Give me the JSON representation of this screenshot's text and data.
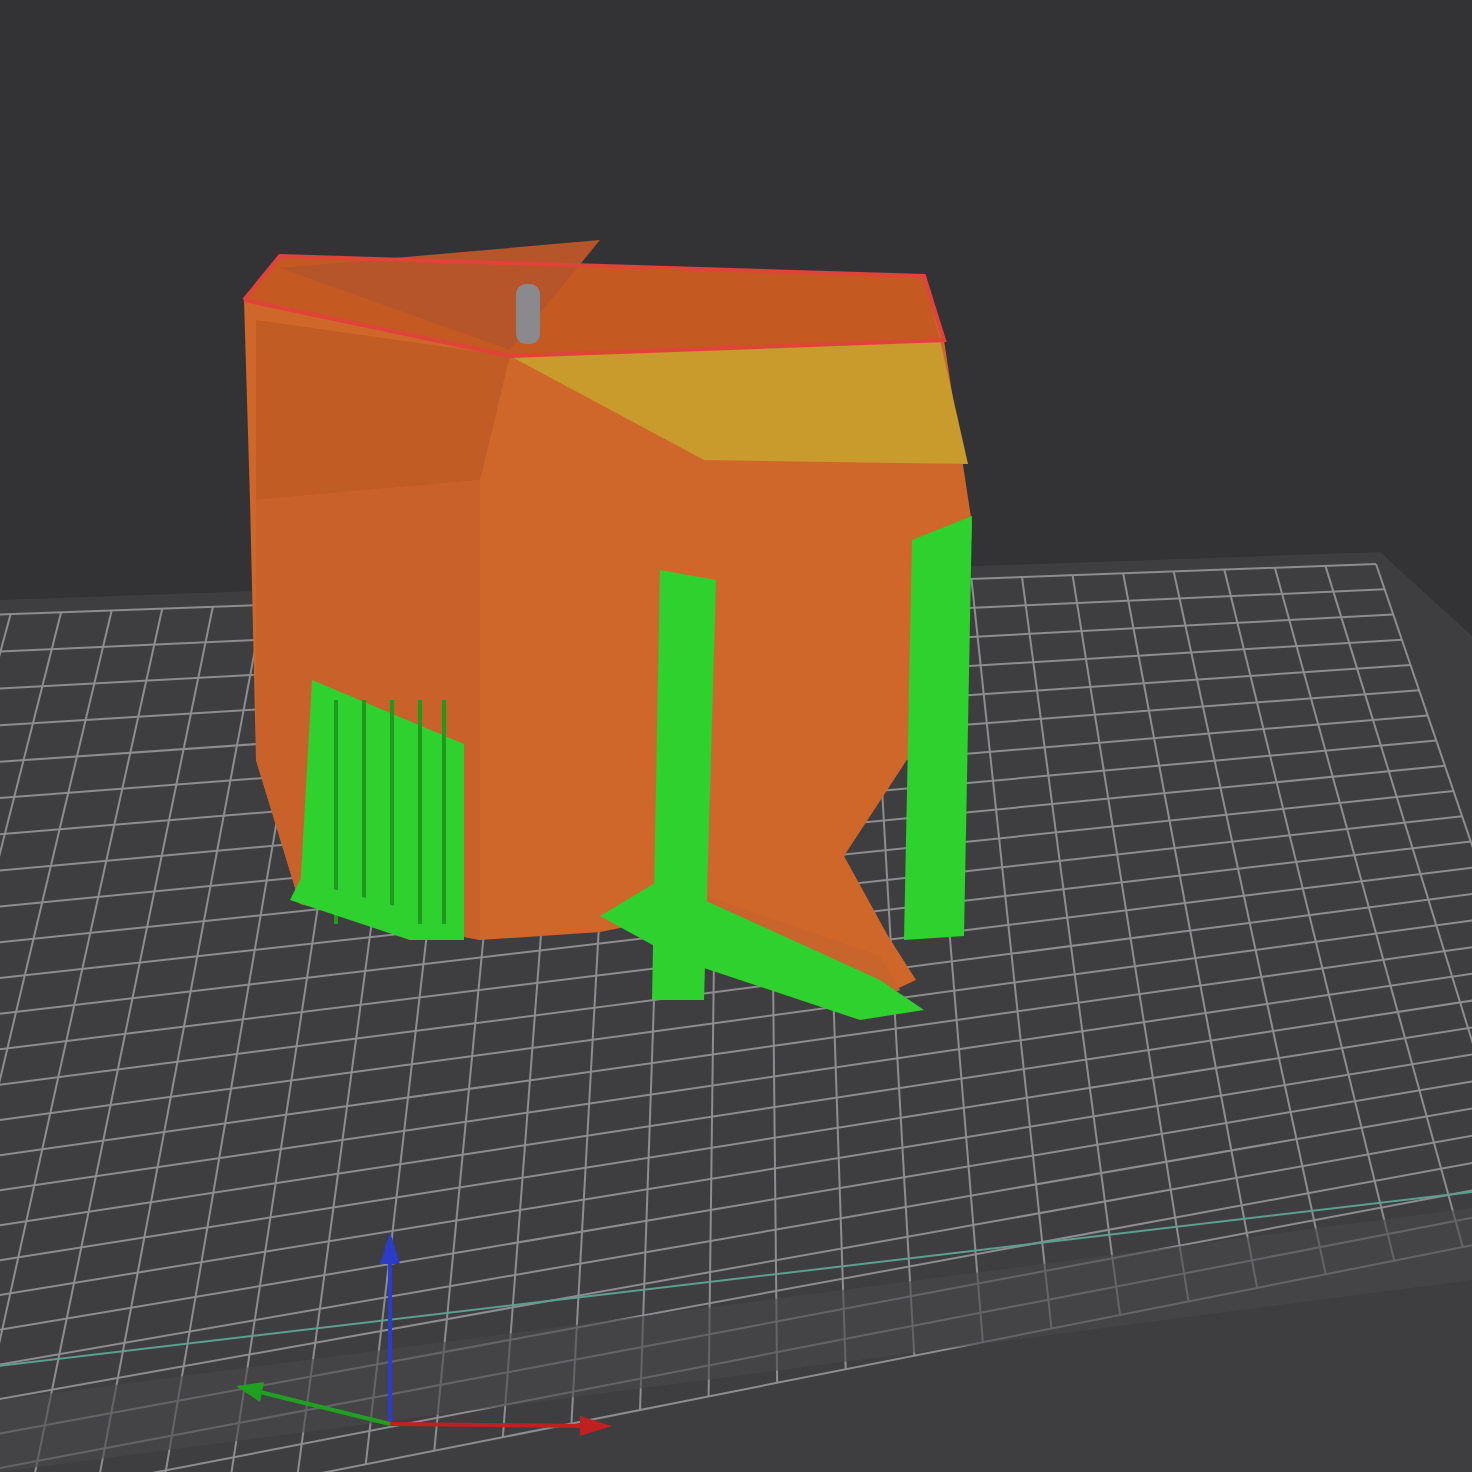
{
  "viewport": {
    "kind": "sliced-preview"
  }
}
